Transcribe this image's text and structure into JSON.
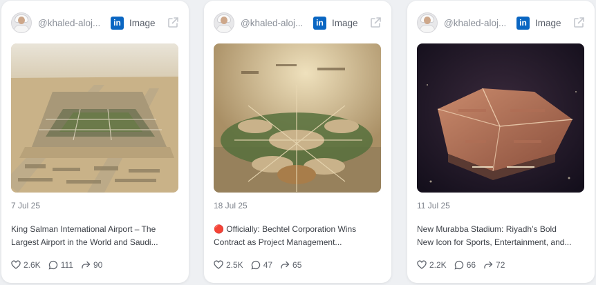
{
  "cards": [
    {
      "handle": "@khaled-aloj...",
      "platform_icon": "linkedin-icon",
      "type_label": "Image",
      "date": "7 Jul 25",
      "text_line1": "King Salman International Airport – The",
      "text_line2": "Largest Airport in the World and Saudi...",
      "likes": "2.6K",
      "comments": "111",
      "shares": "90",
      "image_subject": "airport-aerial-render"
    },
    {
      "handle": "@khaled-aloj...",
      "platform_icon": "linkedin-icon",
      "type_label": "Image",
      "date": "18 Jul 25",
      "text_line1": "🔴 Officially: Bechtel Corporation Wins",
      "text_line2": "Contract as Project Management...",
      "likes": "2.5K",
      "comments": "47",
      "shares": "65",
      "image_subject": "city-master-plan-aerial"
    },
    {
      "handle": "@khaled-aloj...",
      "platform_icon": "linkedin-icon",
      "type_label": "Image",
      "date": "11 Jul 25",
      "text_line1": "New Murabba Stadium: Riyadh’s Bold",
      "text_line2": "New Icon for Sports, Entertainment, and...",
      "likes": "2.2K",
      "comments": "66",
      "shares": "72",
      "image_subject": "stadium-night-render"
    }
  ],
  "colors": {
    "linkedin": "#0a66c2",
    "card_bg": "#ffffff",
    "page_bg": "#eef0f3"
  }
}
